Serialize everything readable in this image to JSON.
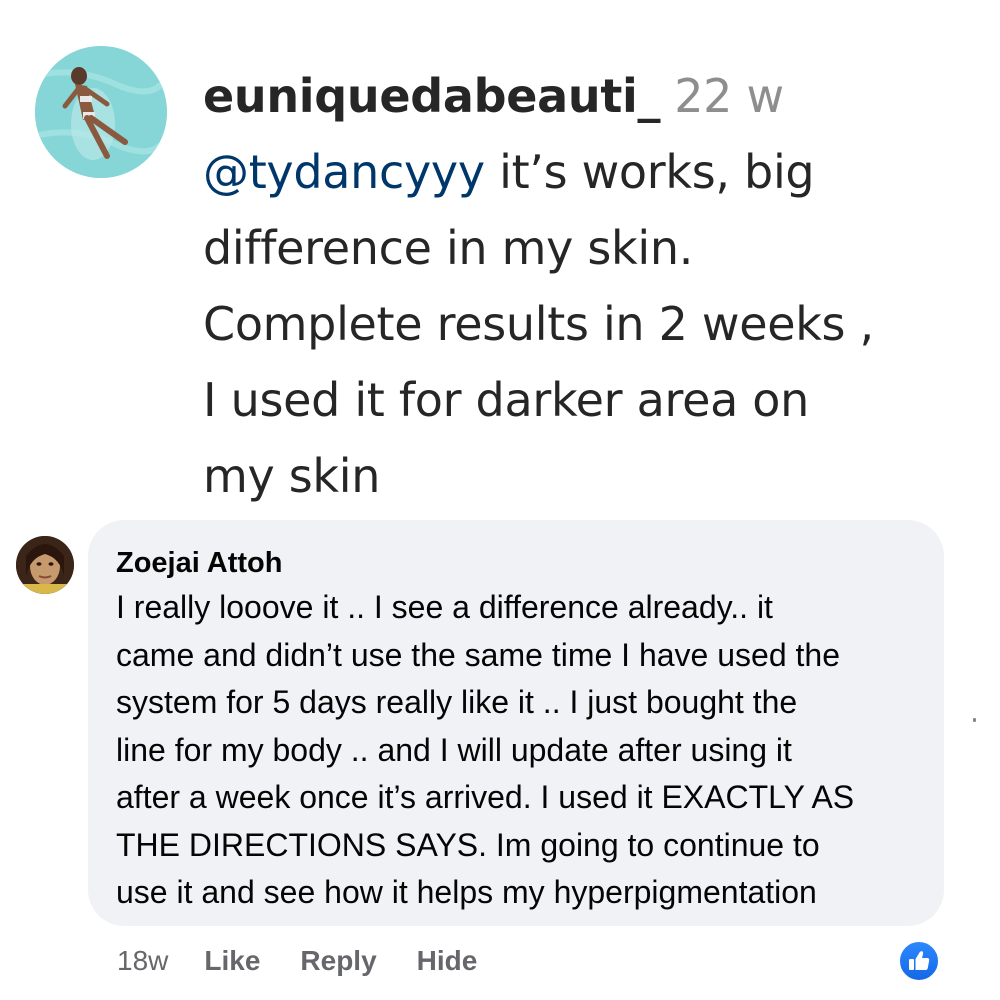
{
  "ig_comment": {
    "avatar_icon": "profile-photo-pool",
    "username": "euniquedabeauti_",
    "time": "22 w",
    "mention": "@tydancyyy",
    "lines": [
      " it’s works, big",
      "difference in my skin.",
      "Complete results in 2 weeks ,",
      "I used it for darker area on",
      "my skin"
    ]
  },
  "fb_comment": {
    "avatar_icon": "profile-photo",
    "author": "Zoejai Attoh",
    "lines": [
      "I really looove it .. I see a difference already.. it",
      "came and didn’t use the same time I have used the",
      "system for 5 days really like it .. I just bought the",
      "line for my body .. and I will update after using it",
      "after a week once it’s arrived. I used it EXACTLY AS",
      "THE DIRECTIONS SAYS. Im going to continue to",
      "use it and see how it helps my hyperpigmentation"
    ],
    "time": "18w",
    "actions": {
      "like": "Like",
      "reply": "Reply",
      "hide": "Hide"
    },
    "reaction_icon": "thumbs-up-icon",
    "colors": {
      "bubble": "#f0f2f5",
      "like_blue": "#1877f2",
      "meta_gray": "#65676b"
    }
  },
  "colors": {
    "mention_blue": "#00376b",
    "timestamp_gray": "#8e8e8e"
  }
}
